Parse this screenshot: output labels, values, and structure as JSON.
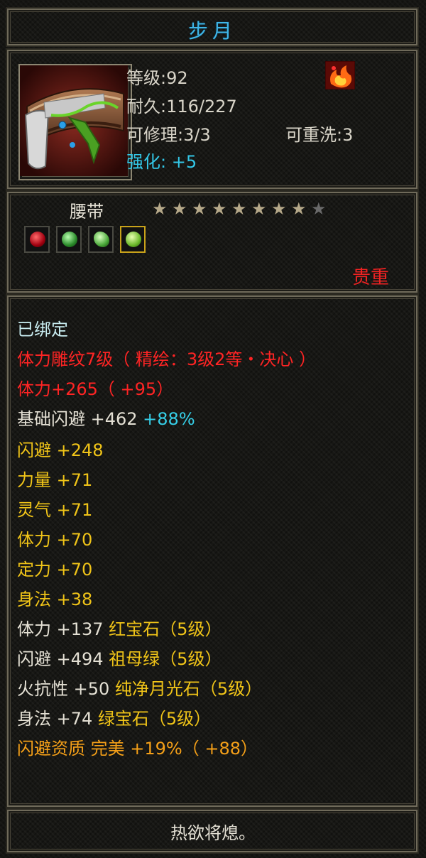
{
  "item": {
    "name": "步月",
    "level": "等级:92",
    "durability": "耐久:116/227",
    "repairable": "可修理:3/3",
    "rewash": "可重洗:3",
    "enhance": "强化: +5",
    "type": "腰带",
    "stars_filled": 8,
    "stars_total": 9,
    "quality": "贵重",
    "flavor": "热欲将熄。"
  },
  "stats": [
    {
      "text": "已绑定"
    },
    {
      "text": "体力雕纹7级（ 精绘：3级2等・决心 ）"
    },
    {
      "text": "体力+265（ +95）"
    },
    {
      "text": "基础闪避  +462",
      "extra": " +88%"
    },
    {
      "text": "闪避  +248"
    },
    {
      "text": "力量  +71"
    },
    {
      "text": "灵气  +71"
    },
    {
      "text": "体力  +70"
    },
    {
      "text": "定力  +70"
    },
    {
      "text": "身法  +38"
    },
    {
      "text": "体力  +137",
      "extra": "  红宝石（5级）"
    },
    {
      "text": "闪避  +494",
      "extra": "  祖母绿（5级）"
    },
    {
      "text": "火抗性  +50",
      "extra": "  纯净月光石（5级）"
    },
    {
      "text": "身法  +74",
      "extra": "  绿宝石（5级）"
    },
    {
      "text": "闪避资质    完美  +19%（ +88）"
    }
  ],
  "colors": {
    "title": "#3fb6e8",
    "enhance": "#33c8e8",
    "quality": "#ee2222",
    "bound": "#c8ecf0",
    "engrave": "#ff2424",
    "base_stat": "#f0c418",
    "gem_stat": "#f0c418",
    "aptitude": "#f5a018"
  },
  "icons": {
    "item": "belt-icon",
    "special": "fire-rune-icon",
    "gems": [
      "ruby-gem-icon",
      "emerald-gem-icon",
      "jade-gem-icon",
      "green-gem-icon"
    ]
  }
}
